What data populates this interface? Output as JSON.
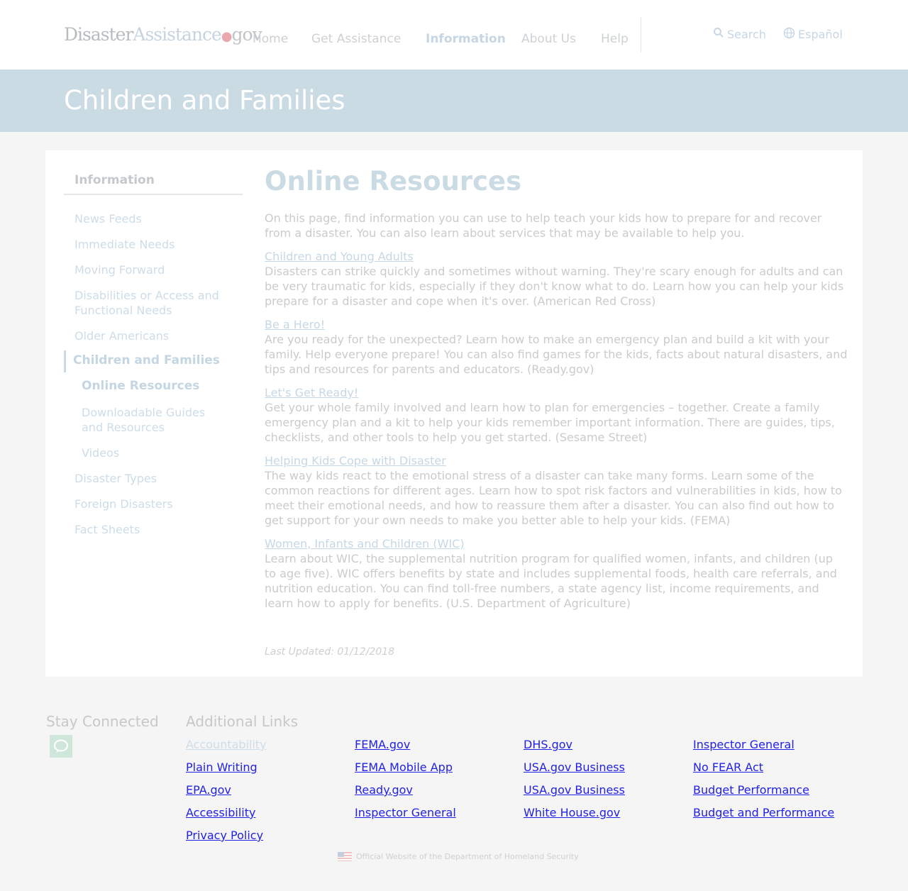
{
  "header": {
    "logo": {
      "part1": "Disaster",
      "part2": "Assistance",
      "dot": "●",
      "part3": "gov"
    },
    "nav": [
      "Home",
      "Get Assistance",
      "Information",
      "About Us",
      "Help"
    ],
    "active_nav": "Information",
    "search_label": "Search",
    "language_label": "Español"
  },
  "banner": {
    "title": "Children and Families"
  },
  "sidebar": {
    "heading": "Information",
    "items": [
      "News Feeds",
      "Immediate Needs",
      "Moving Forward",
      "Disabilities or Access and",
      "Functional Needs",
      "Older Americans",
      "Children and Families",
      "Online Resources",
      "Downloadable Guides",
      "and Resources",
      "Videos",
      "Disaster Types",
      "Foreign Disasters",
      "Fact Sheets"
    ]
  },
  "article": {
    "title": "Online Resources",
    "intro": "On this page, find information you can use to help teach your kids how to prepare for and recover from a disaster. You can also learn about services that may be available to help you.",
    "resources": [
      {
        "link": "Children and Young Adults",
        "text": "Disasters can strike quickly and sometimes without warning. They're scary enough for adults and can be very traumatic for kids, especially if they don't know what to do. Learn how you can help your kids prepare for a disaster and cope when it's over. (American Red Cross)"
      },
      {
        "link": "Be a Hero!",
        "text": "Are you ready for the unexpected? Learn how to make an emergency plan and build a kit with your family. Help everyone prepare! You can also find games for the kids, facts about natural disasters, and tips and resources for parents and educators. (Ready.gov)"
      },
      {
        "link": "Let's Get Ready!",
        "text": "Get your whole family involved and learn how to plan for emergencies – together. Create a family emergency plan and a kit to help your kids remember important information. There are guides, tips, checklists, and other tools to help you get started. (Sesame Street)"
      },
      {
        "link": "Helping Kids Cope with Disaster",
        "text": "The way kids react to the emotional stress of a disaster can take many forms. Learn some of the common reactions for different ages. Learn how to spot risk factors and vulnerabilities in kids, how to meet their emotional needs, and how to reassure them after a disaster. You can also find out how to get support for your own needs to make you better able to help your kids. (FEMA)"
      },
      {
        "link": "Women, Infants and Children (WIC)",
        "text": "Learn about WIC, the supplemental nutrition program for qualified women, infants, and children (up to age five). WIC offers benefits by state and includes supplemental foods, health care referrals, and nutrition education. You can find toll-free numbers, a state agency list, income requirements, and learn how to apply for benefits. (U.S. Department of Agriculture)"
      }
    ],
    "last_updated": "Last Updated: 01/12/2018"
  },
  "footer": {
    "stay_connected": "Stay Connected",
    "additional_links": "Additional Links",
    "links": [
      [
        "Accountability",
        "Plain Writing",
        "EPA.gov",
        "Accessibility",
        "Privacy Policy"
      ],
      [
        "FEMA.gov",
        "FEMA Mobile App",
        "Ready.gov",
        "Inspector General",
        ""
      ],
      [
        "DHS.gov",
        "USA.gov Business",
        "USA.gov Business",
        "White House.gov",
        ""
      ],
      [
        "Inspector General",
        "No FEAR Act",
        "Budget Performance",
        "Budget and Performance",
        ""
      ]
    ],
    "official": "Official Website of the Department of Homeland Security"
  }
}
